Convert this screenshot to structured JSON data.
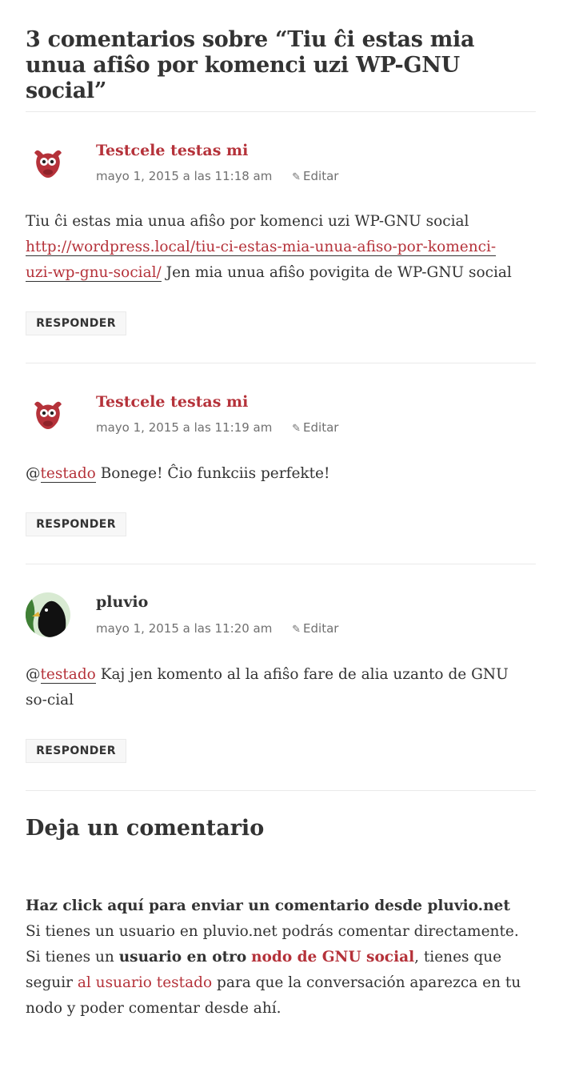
{
  "comments_title": "3 comentarios sobre “Tiu ĉi estas mia unua afiŝo por komenci uzi WP-GNU social”",
  "colors": {
    "accent": "#b5323a",
    "text": "#333333",
    "meta": "#707070",
    "divider": "#eaeaea"
  },
  "comments": [
    {
      "avatar_icon": "cow-avatar-icon",
      "author": "Testcele testas mi",
      "date": "mayo 1, 2015 a las 11:18 am",
      "edit_label": "Editar",
      "text_1": "Tiu ĉi estas mia unua afiŝo por komenci uzi WP-GNU social ",
      "link": "http://wordpress.local/tiu-ci-estas-mia-unua-afiso-por-komenci-uzi-wp-gnu-social/",
      "text_2": " Jen mia unua afiŝo povigita de WP-GNU social",
      "reply_label": "RESPONDER"
    },
    {
      "avatar_icon": "cow-avatar-icon",
      "author": "Testcele testas mi",
      "date": "mayo 1, 2015 a las 11:19 am",
      "edit_label": "Editar",
      "at": "@",
      "mention": "testado",
      "text": " Bonege! Ĉio funkciis perfekte!",
      "reply_label": "RESPONDER"
    },
    {
      "avatar_icon": "bird-avatar-icon",
      "author": "pluvio",
      "date": "mayo 1, 2015 a las 11:20 am",
      "edit_label": "Editar",
      "at": "@",
      "mention": "testado",
      "text": " Kaj jen komento al la afiŝo fare de alia uzanto de GNU so-cial",
      "reply_label": "RESPONDER"
    }
  ],
  "respond": {
    "title": "Deja un comentario",
    "click_here": "Haz click aquí para enviar un comentario desde pluvio.net",
    "line_a": "Si tienes un usuario en pluvio.net podrás comentar directamente. Si tienes un ",
    "bold_other": "usuario en otro",
    "space": " ",
    "node_link": "nodo de GNU social",
    "line_b": ", tienes que seguir ",
    "follow_link": "al usuario testado",
    "line_c": " para que la conversación aparezca en tu nodo y poder comentar desde ahí."
  }
}
